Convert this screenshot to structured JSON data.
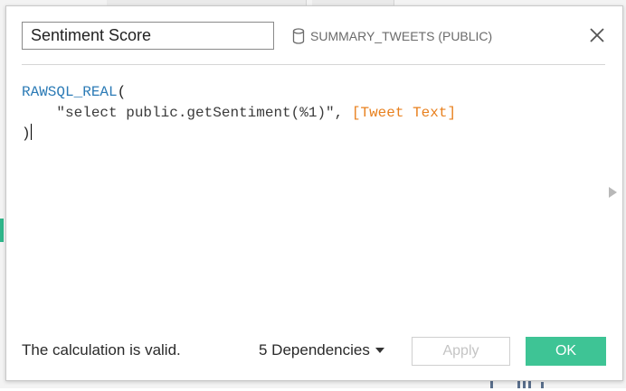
{
  "calculation": {
    "name": "Sentiment Score",
    "data_source": "SUMMARY_TWEETS (PUBLIC)",
    "data_source_icon": "database-icon",
    "close_icon": "close-icon"
  },
  "formula": {
    "line1": {
      "func": "RAWSQL_REAL",
      "open": "("
    },
    "line2": {
      "indent": "    ",
      "string": "\"select public.getSentiment(%1)\"",
      "sep": ", ",
      "field": "[Tweet Text]"
    },
    "line3": {
      "close": ")"
    }
  },
  "footer": {
    "status": "The calculation is valid.",
    "dependencies": "5 Dependencies",
    "apply_label": "Apply",
    "ok_label": "OK"
  },
  "colors": {
    "function": "#2c7bb6",
    "field": "#e8801e",
    "ok_button": "#3ec495"
  }
}
